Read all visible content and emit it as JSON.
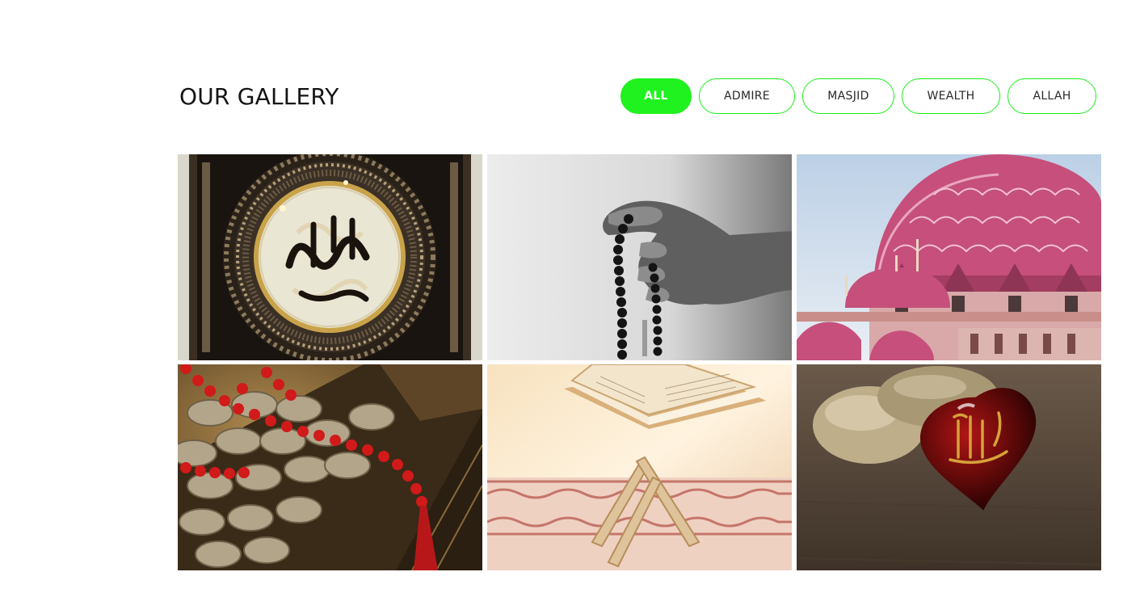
{
  "gallery": {
    "title": "OUR GALLERY",
    "filters": [
      {
        "label": "ALL",
        "active": true
      },
      {
        "label": "ADMIRE",
        "active": false
      },
      {
        "label": "MASJID",
        "active": false
      },
      {
        "label": "WEALTH",
        "active": false
      },
      {
        "label": "ALLAH",
        "active": false
      }
    ],
    "accent_color": "#1ff21f",
    "items": [
      {
        "image": "calligraphy-frame-image",
        "alt": "Arabic calligraphy in ornate gold frame"
      },
      {
        "image": "prayer-beads-hand-image",
        "alt": "Hand holding prayer beads"
      },
      {
        "image": "pink-mosque-dome-image",
        "alt": "Pink mosque dome"
      },
      {
        "image": "coins-chest-image",
        "alt": "Treasure chest with coins and red beads"
      },
      {
        "image": "quran-stand-image",
        "alt": "Open Quran on wooden stand"
      },
      {
        "image": "heart-stone-allah-image",
        "alt": "Red heart stone with Allah calligraphy"
      }
    ]
  }
}
